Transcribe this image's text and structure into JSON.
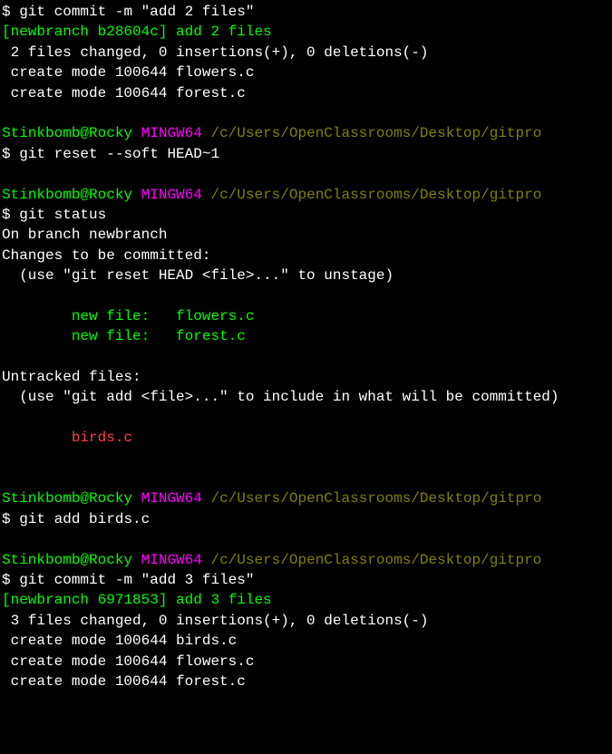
{
  "prompt_symbol": "$",
  "user": "Stinkbomb@Rocky",
  "shell": "MINGW64",
  "path": "/c/Users/OpenClassrooms/Desktop/gitpro",
  "blocks": {
    "commit1": {
      "cmd": "git commit -m \"add 2 files\"",
      "line1": "[newbranch b28604c] add 2 files",
      "line2": " 2 files changed, 0 insertions(+), 0 deletions(-)",
      "line3": " create mode 100644 flowers.c",
      "line4": " create mode 100644 forest.c"
    },
    "reset": {
      "cmd": "git reset --soft HEAD~1"
    },
    "status": {
      "cmd": "git status",
      "branch": "On branch newbranch",
      "staged_header": "Changes to be committed:",
      "staged_hint": "  (use \"git reset HEAD <file>...\" to unstage)",
      "staged_file1": "        new file:   flowers.c",
      "staged_file2": "        new file:   forest.c",
      "untracked_header": "Untracked files:",
      "untracked_hint": "  (use \"git add <file>...\" to include in what will be committed)",
      "untracked_file1": "        birds.c"
    },
    "add": {
      "cmd": "git add birds.c"
    },
    "commit2": {
      "cmd": "git commit -m \"add 3 files\"",
      "line1": "[newbranch 6971853] add 3 files",
      "line2": " 3 files changed, 0 insertions(+), 0 deletions(-)",
      "line3": " create mode 100644 birds.c",
      "line4": " create mode 100644 flowers.c",
      "line5": " create mode 100644 forest.c"
    }
  }
}
